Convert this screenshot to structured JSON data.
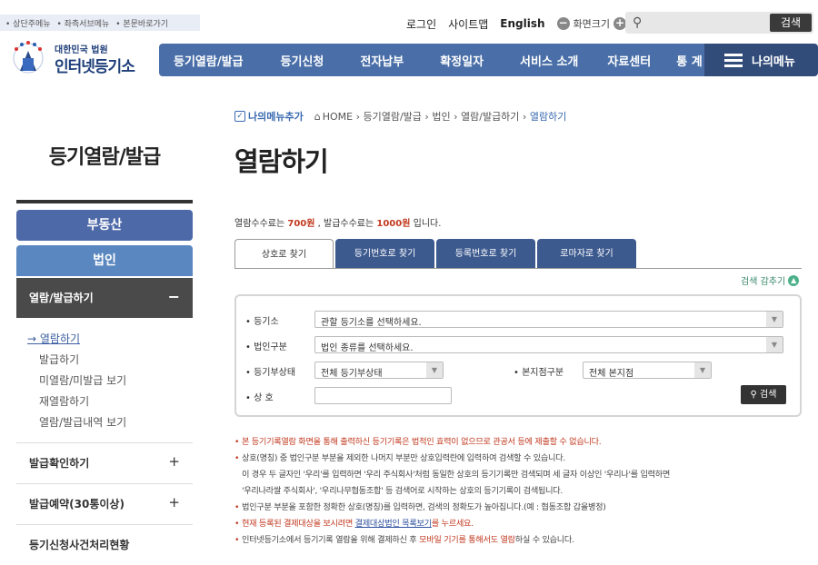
{
  "skip_links": [
    "상단주메뉴",
    "좌측서브메뉴",
    "본문바로가기"
  ],
  "top_links": {
    "login": "로그인",
    "sitemap": "사이트맵",
    "english": "English",
    "zoom_label": "화면크기",
    "zoom_out": "−",
    "zoom_in": "+"
  },
  "search": {
    "button": "검색"
  },
  "logo": {
    "line1": "대한민국 법원",
    "line2": "인터넷등기소"
  },
  "gnb": [
    "등기열람/발급",
    "등기신청",
    "전자납부",
    "확정일자",
    "서비스 소개",
    "자료센터",
    "통 계"
  ],
  "my_menu": "나의메뉴",
  "lnb": {
    "title": "등기열람/발급",
    "btn_realestate": "부동산",
    "btn_corp": "법인",
    "selected_group": "열람/발급하기",
    "sub_items": [
      "열람하기",
      "발급하기",
      "미열람/미발급 보기",
      "재열람하기",
      "열람/발급내역 보기"
    ],
    "groups": [
      "발급확인하기",
      "발급예약(30통이상)",
      "등기신청사건처리현황"
    ]
  },
  "breadcrumb": {
    "my_menu_add": "나의메뉴추가",
    "items": [
      "HOME",
      "등기열람/발급",
      "법인",
      "열람/발급하기",
      "열람하기"
    ]
  },
  "page_title": "열람하기",
  "fee": {
    "pre": "열람수수료는 ",
    "v1": "700원",
    "mid": " , 발급수수료는 ",
    "v2": "1000원",
    "post": " 입니다."
  },
  "tabs": [
    "상호로 찾기",
    "등기번호로 찾기",
    "등록번호로 찾기",
    "로마자로 찾기"
  ],
  "fold_label": "검색 감추기",
  "form": {
    "registry_label": "등기소",
    "registry_value": "관할 등기소를 선택하세요.",
    "corp_type_label": "법인구분",
    "corp_type_value": "법인 종류를 선택하세요.",
    "status_label": "등기부상태",
    "status_value": "전체 등기부상태",
    "branch_label": "본지점구분",
    "branch_value": "전체 본지점",
    "name_label": "상 호",
    "search_btn": "검색"
  },
  "notes": {
    "n1": "본 등기기록열람 화면을 통해 출력하신 등기기록은 법적인 효력이 없으므로 관공서 등에 제출할 수 없습니다.",
    "n2": "상호(명칭) 중 법인구분 부분을 제외한 나머지 부분만 상호입력란에 입력하여 검색할 수 있습니다.",
    "n2b": "이 경우 두 글자인 '우리'를 입력하면 '우리 주식회사'처럼 동일한 상호의 등기기록만 검색되며 세 글자 이상인 '우리나'를 입력하면",
    "n2c": "'우리나라쌀 주식회사', '우리나무협동조합' 등 검색어로 시작하는 상호의 등기기록이 검색됩니다.",
    "n3": "법인구분 부분을 포함한 정확한 상호(명칭)를 입력하면, 검색의 정확도가 높아집니다.(예 : 협동조합 갑을병정)",
    "n4a": "현재 등록된 결제대상을 보시려면 ",
    "n4b": "결제대상법인 목록보기",
    "n4c": "를 누르세요.",
    "n5a": "인터넷등기소에서 등기기록 열람을 위해 결제하신 후 ",
    "n5b": "모바일 기기를 통해서도 열람",
    "n5c": "하실 수 있습니다."
  }
}
